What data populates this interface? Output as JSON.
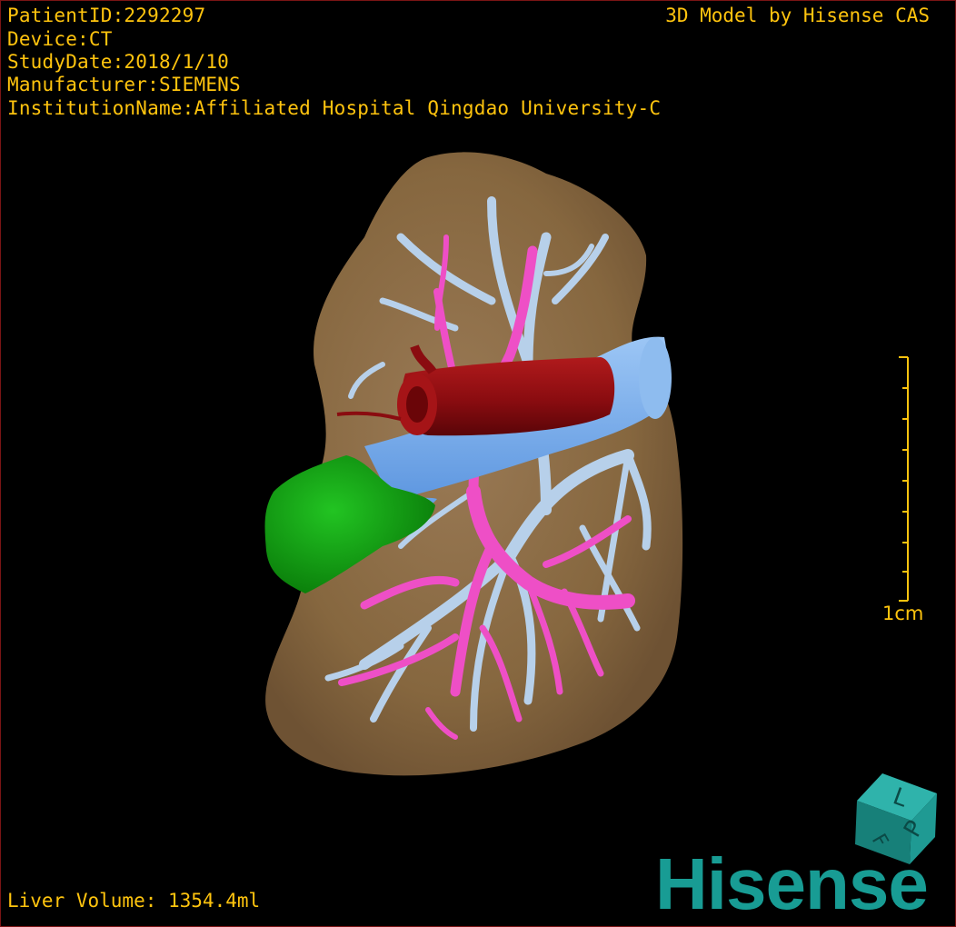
{
  "overlay": {
    "patient_id": "PatientID:2292297",
    "device": "Device:CT",
    "study_date": "StudyDate:2018/1/10",
    "manufacturer": "Manufacturer:SIEMENS",
    "institution": "InstitutionName:Affiliated Hospital Qingdao University-C",
    "brand_line": "3D Model by Hisense CAS",
    "liver_volume": "Liver Volume: 1354.4ml"
  },
  "scale_bar": {
    "label": "1cm",
    "color": "#ffc40e"
  },
  "orientation_cube": {
    "labels": [
      "L",
      "P",
      "F"
    ],
    "color": "#1f9a93"
  },
  "logo": {
    "text": "Hisense",
    "color": "#189c94"
  },
  "model_colors": {
    "liver": "#8a6a47",
    "hepatic_vein": "#b7d0ea",
    "portal_vein": "#ee4fc6",
    "ivc": "#7fb1ee",
    "aorta": "#8a0c10",
    "tumor": "#11a311"
  }
}
